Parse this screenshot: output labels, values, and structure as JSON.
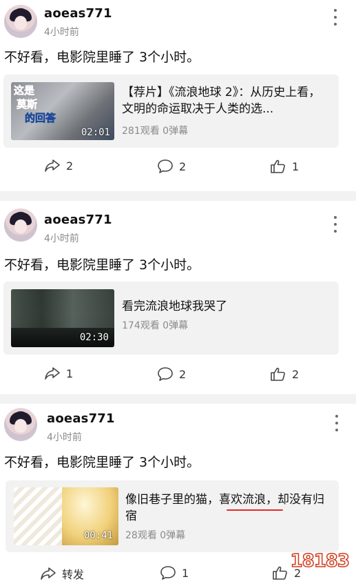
{
  "posts": [
    {
      "username": "aoeas771",
      "time": "4小时前",
      "text": "不好看，电影院里睡了 3个小时。",
      "video": {
        "title": "【荐片】《流浪地球 2》：从历史上看，文明的命运取决于人类的选...",
        "duration": "02:01",
        "stats": "281观看 0弹幕"
      },
      "actions": {
        "share": "2",
        "comment": "2",
        "like": "1"
      }
    },
    {
      "username": "aoeas771",
      "time": "4小时前",
      "text": "不好看，电影院里睡了 3个小时。",
      "video": {
        "title": "看完流浪地球我哭了",
        "duration": "02:30",
        "stats": "174观看 0弹幕"
      },
      "actions": {
        "share": "1",
        "comment": "2",
        "like": "2"
      }
    },
    {
      "username": "aoeas771",
      "time": "4小时前",
      "text": "不好看，电影院里睡了 3个小时。",
      "video": {
        "title": "像旧巷子里的猫，喜欢流浪，却没有归宿",
        "duration": "00:41",
        "stats": "28观看 0弹幕"
      },
      "actions": {
        "share": "转发",
        "comment": "1",
        "like": "2"
      }
    }
  ],
  "thumb_overlay_1": {
    "line1": "这是",
    "line2": "莫斯",
    "line3": "的回答"
  },
  "watermark": "18183",
  "icons": {
    "share": "share-arrow-icon",
    "comment": "comment-bubble-icon",
    "like": "thumbs-up-icon",
    "more": "more-vertical-icon"
  },
  "colors": {
    "underline": "#e52a2a",
    "card_bg": "#f2f2f2",
    "meta_gray": "#8a8a8a"
  }
}
